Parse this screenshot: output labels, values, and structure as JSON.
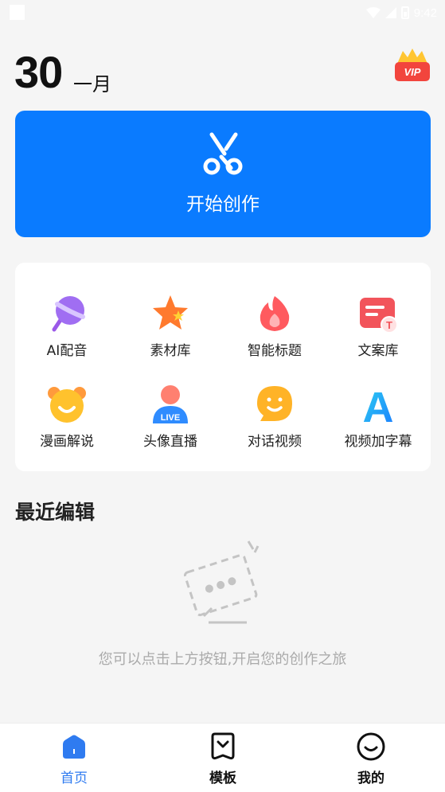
{
  "status_bar": {
    "time": "9:42"
  },
  "header": {
    "day": "30",
    "month": "一月",
    "vip_label": "VIP"
  },
  "start_card": {
    "label": "开始创作"
  },
  "tools": [
    {
      "label": "AI配音",
      "icon": "lollipop-icon"
    },
    {
      "label": "素材库",
      "icon": "star-icon"
    },
    {
      "label": "智能标题",
      "icon": "flame-icon"
    },
    {
      "label": "文案库",
      "icon": "text-card-icon"
    },
    {
      "label": "漫画解说",
      "icon": "bear-face-icon"
    },
    {
      "label": "头像直播",
      "icon": "live-avatar-icon"
    },
    {
      "label": "对话视频",
      "icon": "chat-smile-icon"
    },
    {
      "label": "视频加字幕",
      "icon": "letter-a-icon"
    }
  ],
  "live_badge": "LIVE",
  "text_badge": "T",
  "letter_a": "A",
  "recent": {
    "title": "最近编辑",
    "empty_message": "您可以点击上方按钮,开启您的创作之旅"
  },
  "bottom_nav": [
    {
      "label": "首页",
      "active": true
    },
    {
      "label": "模板",
      "active": false
    },
    {
      "label": "我的",
      "active": false
    }
  ],
  "colors": {
    "accent": "#0a7bff",
    "nav_active": "#2f7bf0"
  }
}
